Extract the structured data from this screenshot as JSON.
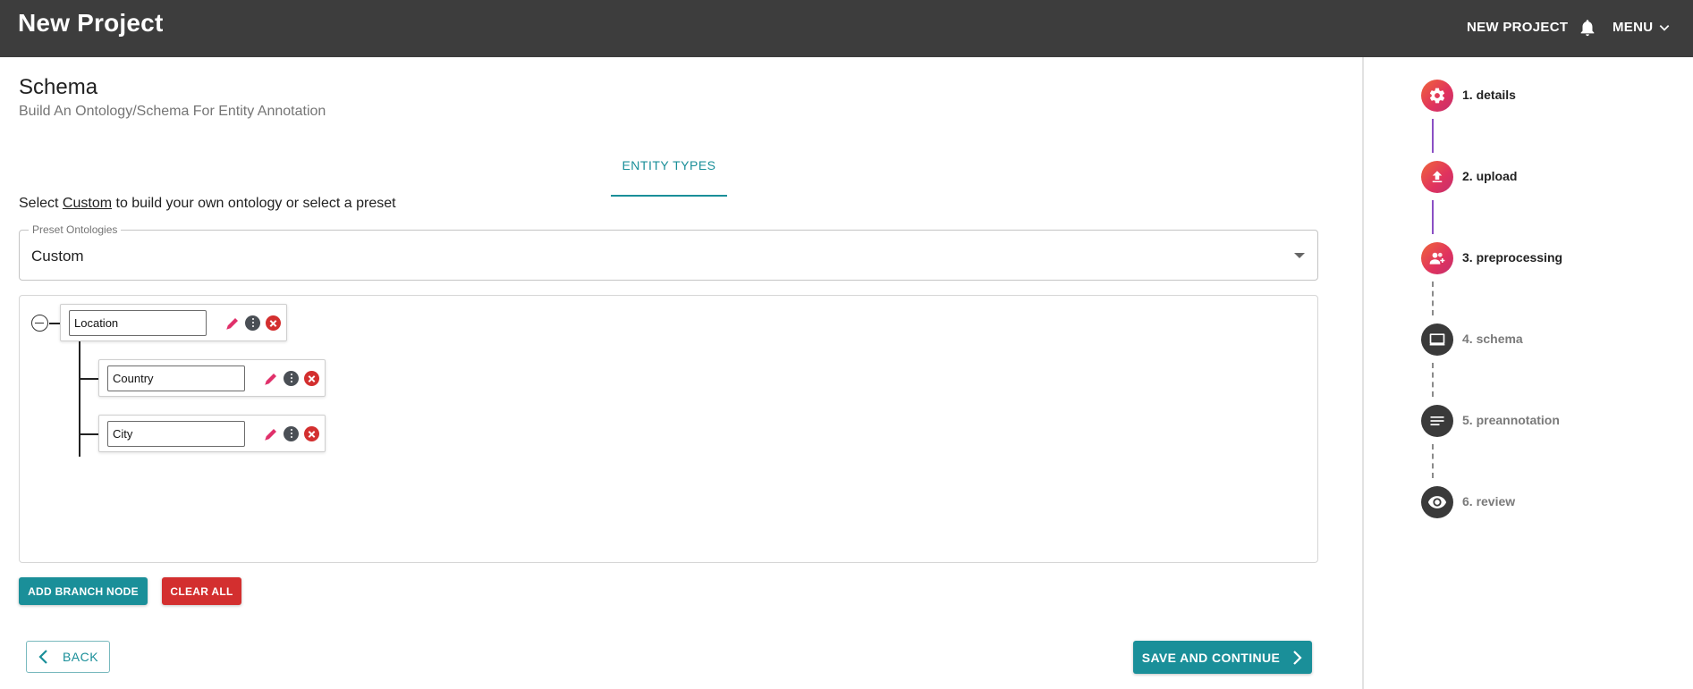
{
  "header": {
    "title": "New Project",
    "new_project_label": "NEW PROJECT",
    "menu_label": "MENU"
  },
  "schema": {
    "title": "Schema",
    "subtitle": "Build An Ontology/Schema For Entity Annotation",
    "tab_label": "ENTITY TYPES",
    "hint_prefix": "Select ",
    "hint_link": "Custom",
    "hint_suffix": " to build your own ontology or select a preset",
    "preset_label": "Preset Ontologies",
    "preset_value": "Custom"
  },
  "tree": {
    "root": {
      "name": "Location"
    },
    "children": [
      {
        "name": "Country"
      },
      {
        "name": "City"
      }
    ]
  },
  "actions": {
    "add_branch": "ADD BRANCH NODE",
    "clear_all": "CLEAR ALL",
    "back": "BACK",
    "save_continue": "SAVE AND CONTINUE"
  },
  "stepper": {
    "steps": [
      {
        "label": "1. details",
        "icon": "gear-icon",
        "state": "done"
      },
      {
        "label": "2. upload",
        "icon": "upload-icon",
        "state": "done"
      },
      {
        "label": "3. preprocessing",
        "icon": "people-icon",
        "state": "done"
      },
      {
        "label": "4. schema",
        "icon": "monitor-icon",
        "state": "todo"
      },
      {
        "label": "5. preannotation",
        "icon": "text-lines-icon",
        "state": "todo"
      },
      {
        "label": "6. review",
        "icon": "eye-icon",
        "state": "todo"
      }
    ]
  },
  "colors": {
    "primary": "#1a8f99",
    "danger": "#d32f2f",
    "topbar": "#3d3d3d",
    "step_active_start": "#f0653a",
    "step_active_end": "#c2306e",
    "step_inactive": "#3a3a3a",
    "connector_done": "#8a4fc4"
  }
}
